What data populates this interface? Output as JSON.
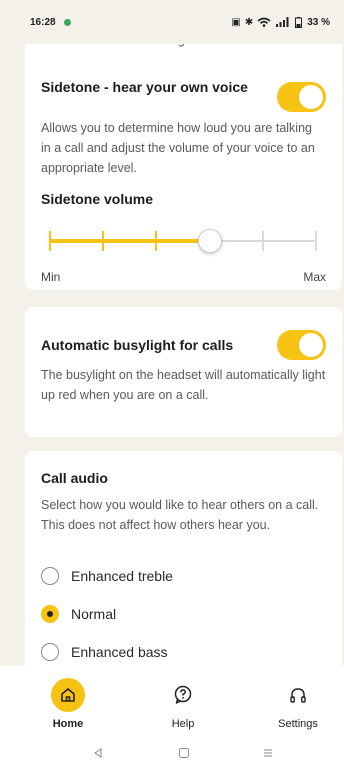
{
  "status": {
    "time": "16:28",
    "battery": "33 %"
  },
  "sidetone_card": {
    "prev_desc_tail": "Reduces unwanted background sounds.",
    "title": "Sidetone - hear your own voice",
    "desc": "Allows you to determine how loud you are talking in a call and adjust the volume of your voice to an appropriate level.",
    "enabled": true,
    "volume_label": "Sidetone volume",
    "volume_value": 0.6,
    "min_label": "Min",
    "max_label": "Max"
  },
  "busylight_card": {
    "title": "Automatic busylight for calls",
    "desc": "The busylight on the headset will automatically light up red when you are on a call.",
    "enabled": true
  },
  "call_audio_card": {
    "title": "Call audio",
    "desc": "Select how you would like to hear others on a call. This does not affect how others hear you.",
    "options": [
      {
        "label": "Enhanced treble",
        "selected": false
      },
      {
        "label": "Normal",
        "selected": true
      },
      {
        "label": "Enhanced bass",
        "selected": false
      }
    ]
  },
  "nav": {
    "items": [
      {
        "label": "Home",
        "icon": "home-icon",
        "active": true
      },
      {
        "label": "Help",
        "icon": "help-icon",
        "active": false
      },
      {
        "label": "Settings",
        "icon": "headset-icon",
        "active": false
      }
    ]
  },
  "colors": {
    "accent": "#f6c313",
    "background": "#f4f0ea",
    "card": "#ffffff"
  }
}
